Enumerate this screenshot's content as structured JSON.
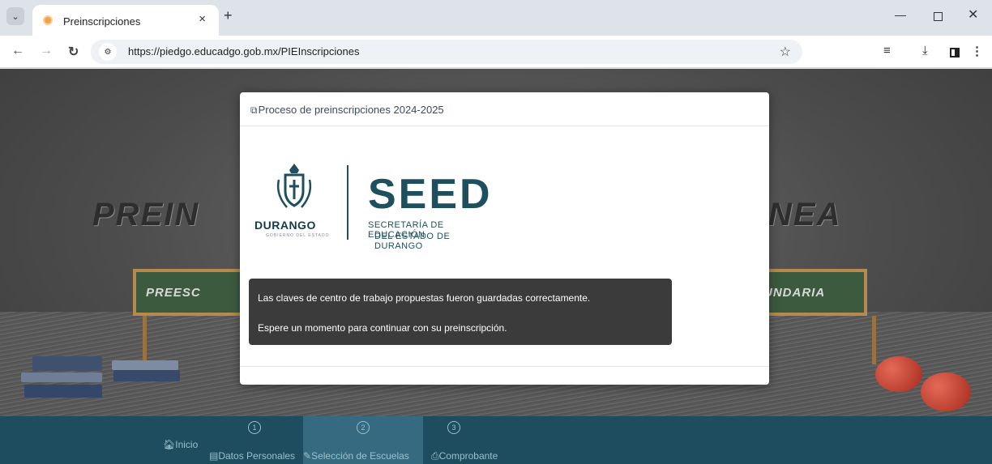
{
  "browser": {
    "tab_title": "Preinscripciones",
    "tab_close": "×",
    "new_tab": "+",
    "url": "https://piedgo.educadgo.gob.mx/PIEInscripciones",
    "icons": [
      "tab-search-icon",
      "back-icon",
      "forward-icon",
      "reload-icon",
      "site-info-icon",
      "bookmark-star-icon",
      "media-control-icon",
      "download-icon",
      "side-panel-icon",
      "menu-icon"
    ]
  },
  "background": {
    "banner_left": "PREIN",
    "banner_right": "NEA",
    "board_left": "PREESC",
    "board_right": "UNDARIA"
  },
  "modal": {
    "title": "Proceso de preinscripciones 2024-2025",
    "logo": {
      "durango": "DURANGO",
      "durango_sub": "GOBIERNO DEL ESTADO",
      "seed": "SEED",
      "seed_line1": "SECRETARÍA DE EDUCACIÓN",
      "seed_line2": "DEL ESTADO DE DURANGO"
    },
    "toast": {
      "line1": "Las claves de centro de trabajo propuestas fueron guardadas correctamente.",
      "line2": "Espere un momento para continuar con su preinscripción."
    }
  },
  "nav": {
    "inicio": "Inicio",
    "steps": [
      {
        "number": "1",
        "label": "Datos Personales",
        "active": false
      },
      {
        "number": "2",
        "label": "Selección de Escuelas",
        "active": true
      },
      {
        "number": "3",
        "label": "Comprobante",
        "active": false
      }
    ]
  },
  "colors": {
    "nav_band": "#1d4d5e",
    "nav_active": "#356a80",
    "seed_brand": "#1e4f5f",
    "toast_bg": "#3b3b3b"
  }
}
